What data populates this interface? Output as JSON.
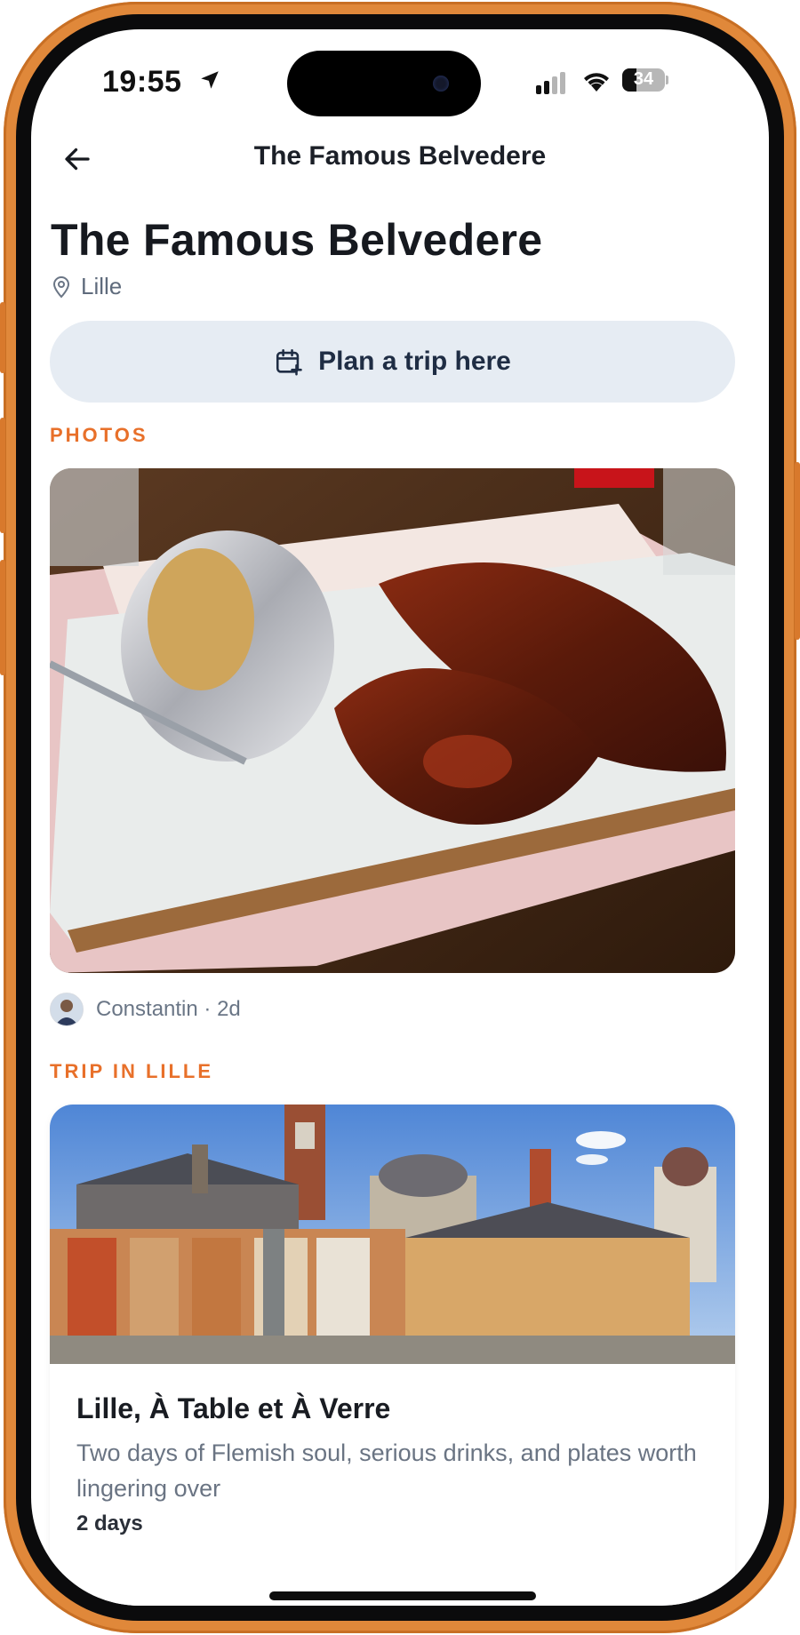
{
  "status": {
    "time": "19:55",
    "battery": "34"
  },
  "nav": {
    "title": "The Famous Belvedere"
  },
  "place": {
    "name": "The Famous Belvedere",
    "location": "Lille"
  },
  "actions": {
    "plan_trip": "Plan a trip here"
  },
  "photos": {
    "section_label": "PHOTOS",
    "author": "Constantin · 2d"
  },
  "trip": {
    "section_label": "TRIP IN LILLE",
    "title": "Lille, À Table et À Verre",
    "description": "Two days of Flemish soul, serious drinks, and plates worth lingering over",
    "duration": "2 days"
  },
  "colors": {
    "accent": "#e8702a",
    "frame": "#e0883a",
    "button_bg": "#e6ecf3"
  },
  "icons": [
    "back-arrow-icon",
    "location-pin-icon",
    "calendar-plus-icon",
    "location-arrow-icon",
    "signal-icon",
    "wifi-icon",
    "battery-icon"
  ]
}
